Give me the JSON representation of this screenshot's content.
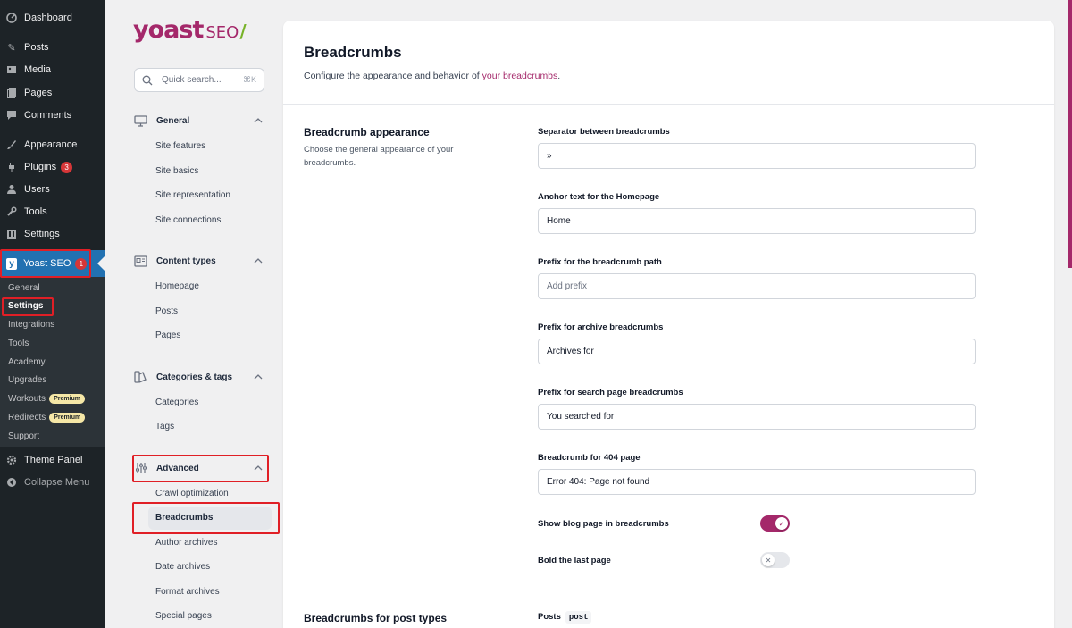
{
  "wp_menu": {
    "items": [
      {
        "label": "Dashboard",
        "icon": "dashboard-icon"
      },
      {
        "label": "Posts",
        "icon": "pin-icon"
      },
      {
        "label": "Media",
        "icon": "media-icon"
      },
      {
        "label": "Pages",
        "icon": "pages-icon"
      },
      {
        "label": "Comments",
        "icon": "comments-icon"
      },
      {
        "label": "Appearance",
        "icon": "brush-icon"
      },
      {
        "label": "Plugins",
        "icon": "plug-icon",
        "badge": "3"
      },
      {
        "label": "Users",
        "icon": "users-icon"
      },
      {
        "label": "Tools",
        "icon": "wrench-icon"
      },
      {
        "label": "Settings",
        "icon": "settings-icon"
      },
      {
        "label": "Yoast SEO",
        "icon": "yoast-icon",
        "badge": "1"
      },
      {
        "label": "Theme Panel",
        "icon": "gear-icon"
      },
      {
        "label": "Collapse Menu",
        "icon": "collapse-icon"
      }
    ],
    "submenu": [
      {
        "label": "General"
      },
      {
        "label": "Settings"
      },
      {
        "label": "Integrations"
      },
      {
        "label": "Tools"
      },
      {
        "label": "Academy"
      },
      {
        "label": "Upgrades"
      },
      {
        "label": "Workouts",
        "badge": "Premium"
      },
      {
        "label": "Redirects",
        "badge": "Premium"
      },
      {
        "label": "Support"
      }
    ]
  },
  "yoast_nav": {
    "logo_text": "yoast",
    "logo_suffix": "SEO",
    "logo_slash": "/",
    "search_placeholder": "Quick search...",
    "search_shortcut": "⌘K",
    "groups": [
      {
        "label": "General",
        "items": [
          "Site features",
          "Site basics",
          "Site representation",
          "Site connections"
        ]
      },
      {
        "label": "Content types",
        "items": [
          "Homepage",
          "Posts",
          "Pages"
        ]
      },
      {
        "label": "Categories & tags",
        "items": [
          "Categories",
          "Tags"
        ]
      },
      {
        "label": "Advanced",
        "items": [
          "Crawl optimization",
          "Breadcrumbs",
          "Author archives",
          "Date archives",
          "Format archives",
          "Special pages"
        ]
      }
    ]
  },
  "main": {
    "title": "Breadcrumbs",
    "description_prefix": "Configure the appearance and behavior of ",
    "description_link": "your breadcrumbs",
    "description_suffix": ".",
    "section1": {
      "title": "Breadcrumb appearance",
      "description": "Choose the general appearance of your breadcrumbs.",
      "fields": [
        {
          "label": "Separator between breadcrumbs",
          "value": "»",
          "placeholder": ""
        },
        {
          "label": "Anchor text for the Homepage",
          "value": "Home",
          "placeholder": ""
        },
        {
          "label": "Prefix for the breadcrumb path",
          "value": "",
          "placeholder": "Add prefix"
        },
        {
          "label": "Prefix for archive breadcrumbs",
          "value": "Archives for",
          "placeholder": ""
        },
        {
          "label": "Prefix for search page breadcrumbs",
          "value": "You searched for",
          "placeholder": ""
        },
        {
          "label": "Breadcrumb for 404 page",
          "value": "Error 404: Page not found",
          "placeholder": ""
        }
      ],
      "toggles": [
        {
          "label": "Show blog page in breadcrumbs",
          "on": true
        },
        {
          "label": "Bold the last page",
          "on": false
        }
      ]
    },
    "section2": {
      "title": "Breadcrumbs for post types",
      "row_label": "Posts",
      "row_code": "post"
    }
  },
  "colors": {
    "accent": "#a4286a",
    "wp_sidebar": "#1d2327",
    "wp_active": "#2271b1",
    "highlight": "#e01f26"
  }
}
